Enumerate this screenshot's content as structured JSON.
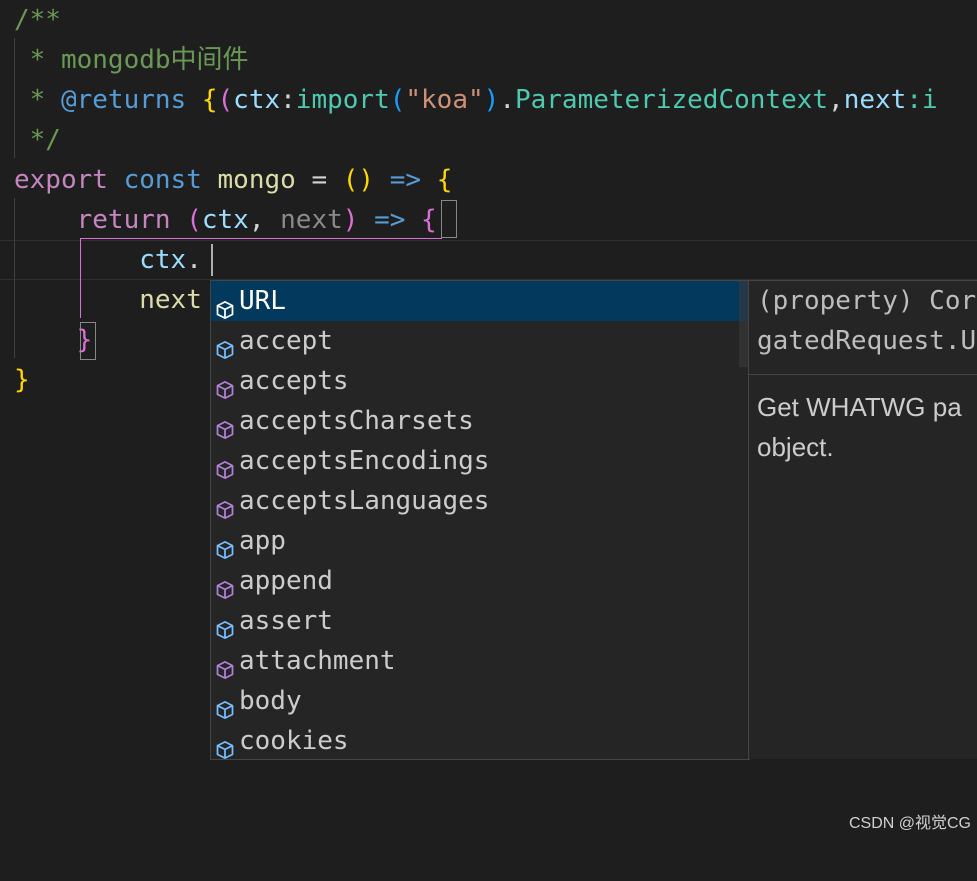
{
  "code": {
    "l1": "/**",
    "l2_star": " * ",
    "l2_text": "mongodb中间件",
    "l3_star": " * ",
    "l3_tag": "@returns",
    "l3_b1": "{",
    "l3_b2": "(",
    "l3_ctx": "ctx",
    "l3_colon": ":",
    "l3_import": "import",
    "l3_b3": "(",
    "l3_str": "\"koa\"",
    "l3_b3c": ")",
    "l3_dot": ".",
    "l3_type": "ParameterizedContext",
    "l3_comma": ",",
    "l3_next": "next",
    "l3_rest": ":i",
    "l4": " */",
    "l5_export": "export",
    "l5_const": "const",
    "l5_name": "mongo",
    "l5_eq": "=",
    "l5_paren": "()",
    "l5_arrow": "=>",
    "l5_brace": "{",
    "l6_return": "return",
    "l6_open": "(",
    "l6_ctx": "ctx",
    "l6_comma": ",",
    "l6_next": "next",
    "l6_close": ")",
    "l6_arrow": "=>",
    "l6_brace": "{",
    "l7_ctx": "ctx",
    "l7_dot": ".",
    "l8_next": "next",
    "l9_brace": "}",
    "l10_brace": "}"
  },
  "suggestions": [
    {
      "label": "URL",
      "icon": "field-icon"
    },
    {
      "label": "accept",
      "icon": "field-icon"
    },
    {
      "label": "accepts",
      "icon": "method-icon"
    },
    {
      "label": "acceptsCharsets",
      "icon": "method-icon"
    },
    {
      "label": "acceptsEncodings",
      "icon": "method-icon"
    },
    {
      "label": "acceptsLanguages",
      "icon": "method-icon"
    },
    {
      "label": "app",
      "icon": "field-icon"
    },
    {
      "label": "append",
      "icon": "method-icon"
    },
    {
      "label": "assert",
      "icon": "field-icon"
    },
    {
      "label": "attachment",
      "icon": "method-icon"
    },
    {
      "label": "body",
      "icon": "field-icon"
    },
    {
      "label": "cookies",
      "icon": "field-icon"
    }
  ],
  "details": {
    "signature_line1": "(property) Cor",
    "signature_line2": "gatedRequest.U",
    "doc_line1": "Get WHATWG pa",
    "doc_line2": "object."
  },
  "watermark": "CSDN @视觉CG",
  "colors": {
    "field_icon": "#75beff",
    "method_icon": "#b180d7",
    "selection": "#04395e"
  }
}
